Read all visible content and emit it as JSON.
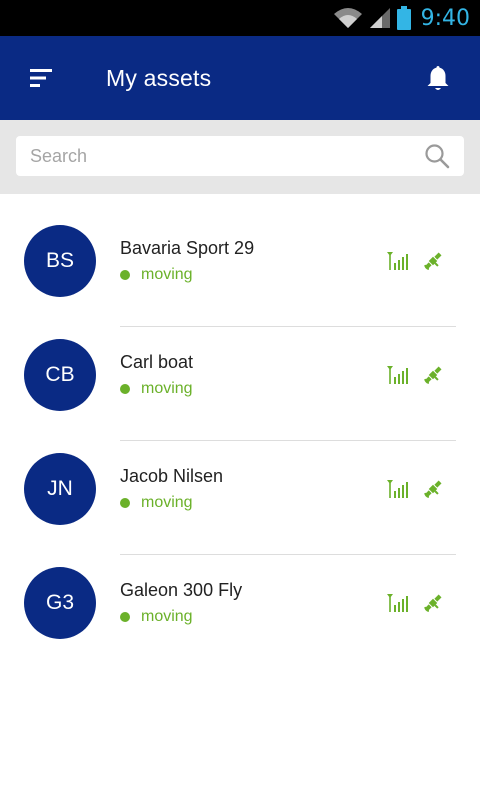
{
  "status_bar": {
    "time": "9:40",
    "icons": [
      "wifi-icon",
      "cell-signal-icon",
      "battery-icon"
    ]
  },
  "app_bar": {
    "title": "My assets",
    "menu_icon": "filter-menu-icon",
    "notification_icon": "bell-icon"
  },
  "search": {
    "placeholder": "Search",
    "value": "",
    "icon": "search-icon"
  },
  "assets": [
    {
      "initials": "BS",
      "name": "Bavaria Sport 29",
      "status": "moving"
    },
    {
      "initials": "CB",
      "name": "Carl boat",
      "status": "moving"
    },
    {
      "initials": "JN",
      "name": "Jacob Nilsen",
      "status": "moving"
    },
    {
      "initials": "G3",
      "name": "Galeon 300 Fly",
      "status": "moving"
    }
  ],
  "colors": {
    "primary": "#0a2a84",
    "status_green": "#6bb12a",
    "status_bar_accent": "#33b5e5"
  }
}
